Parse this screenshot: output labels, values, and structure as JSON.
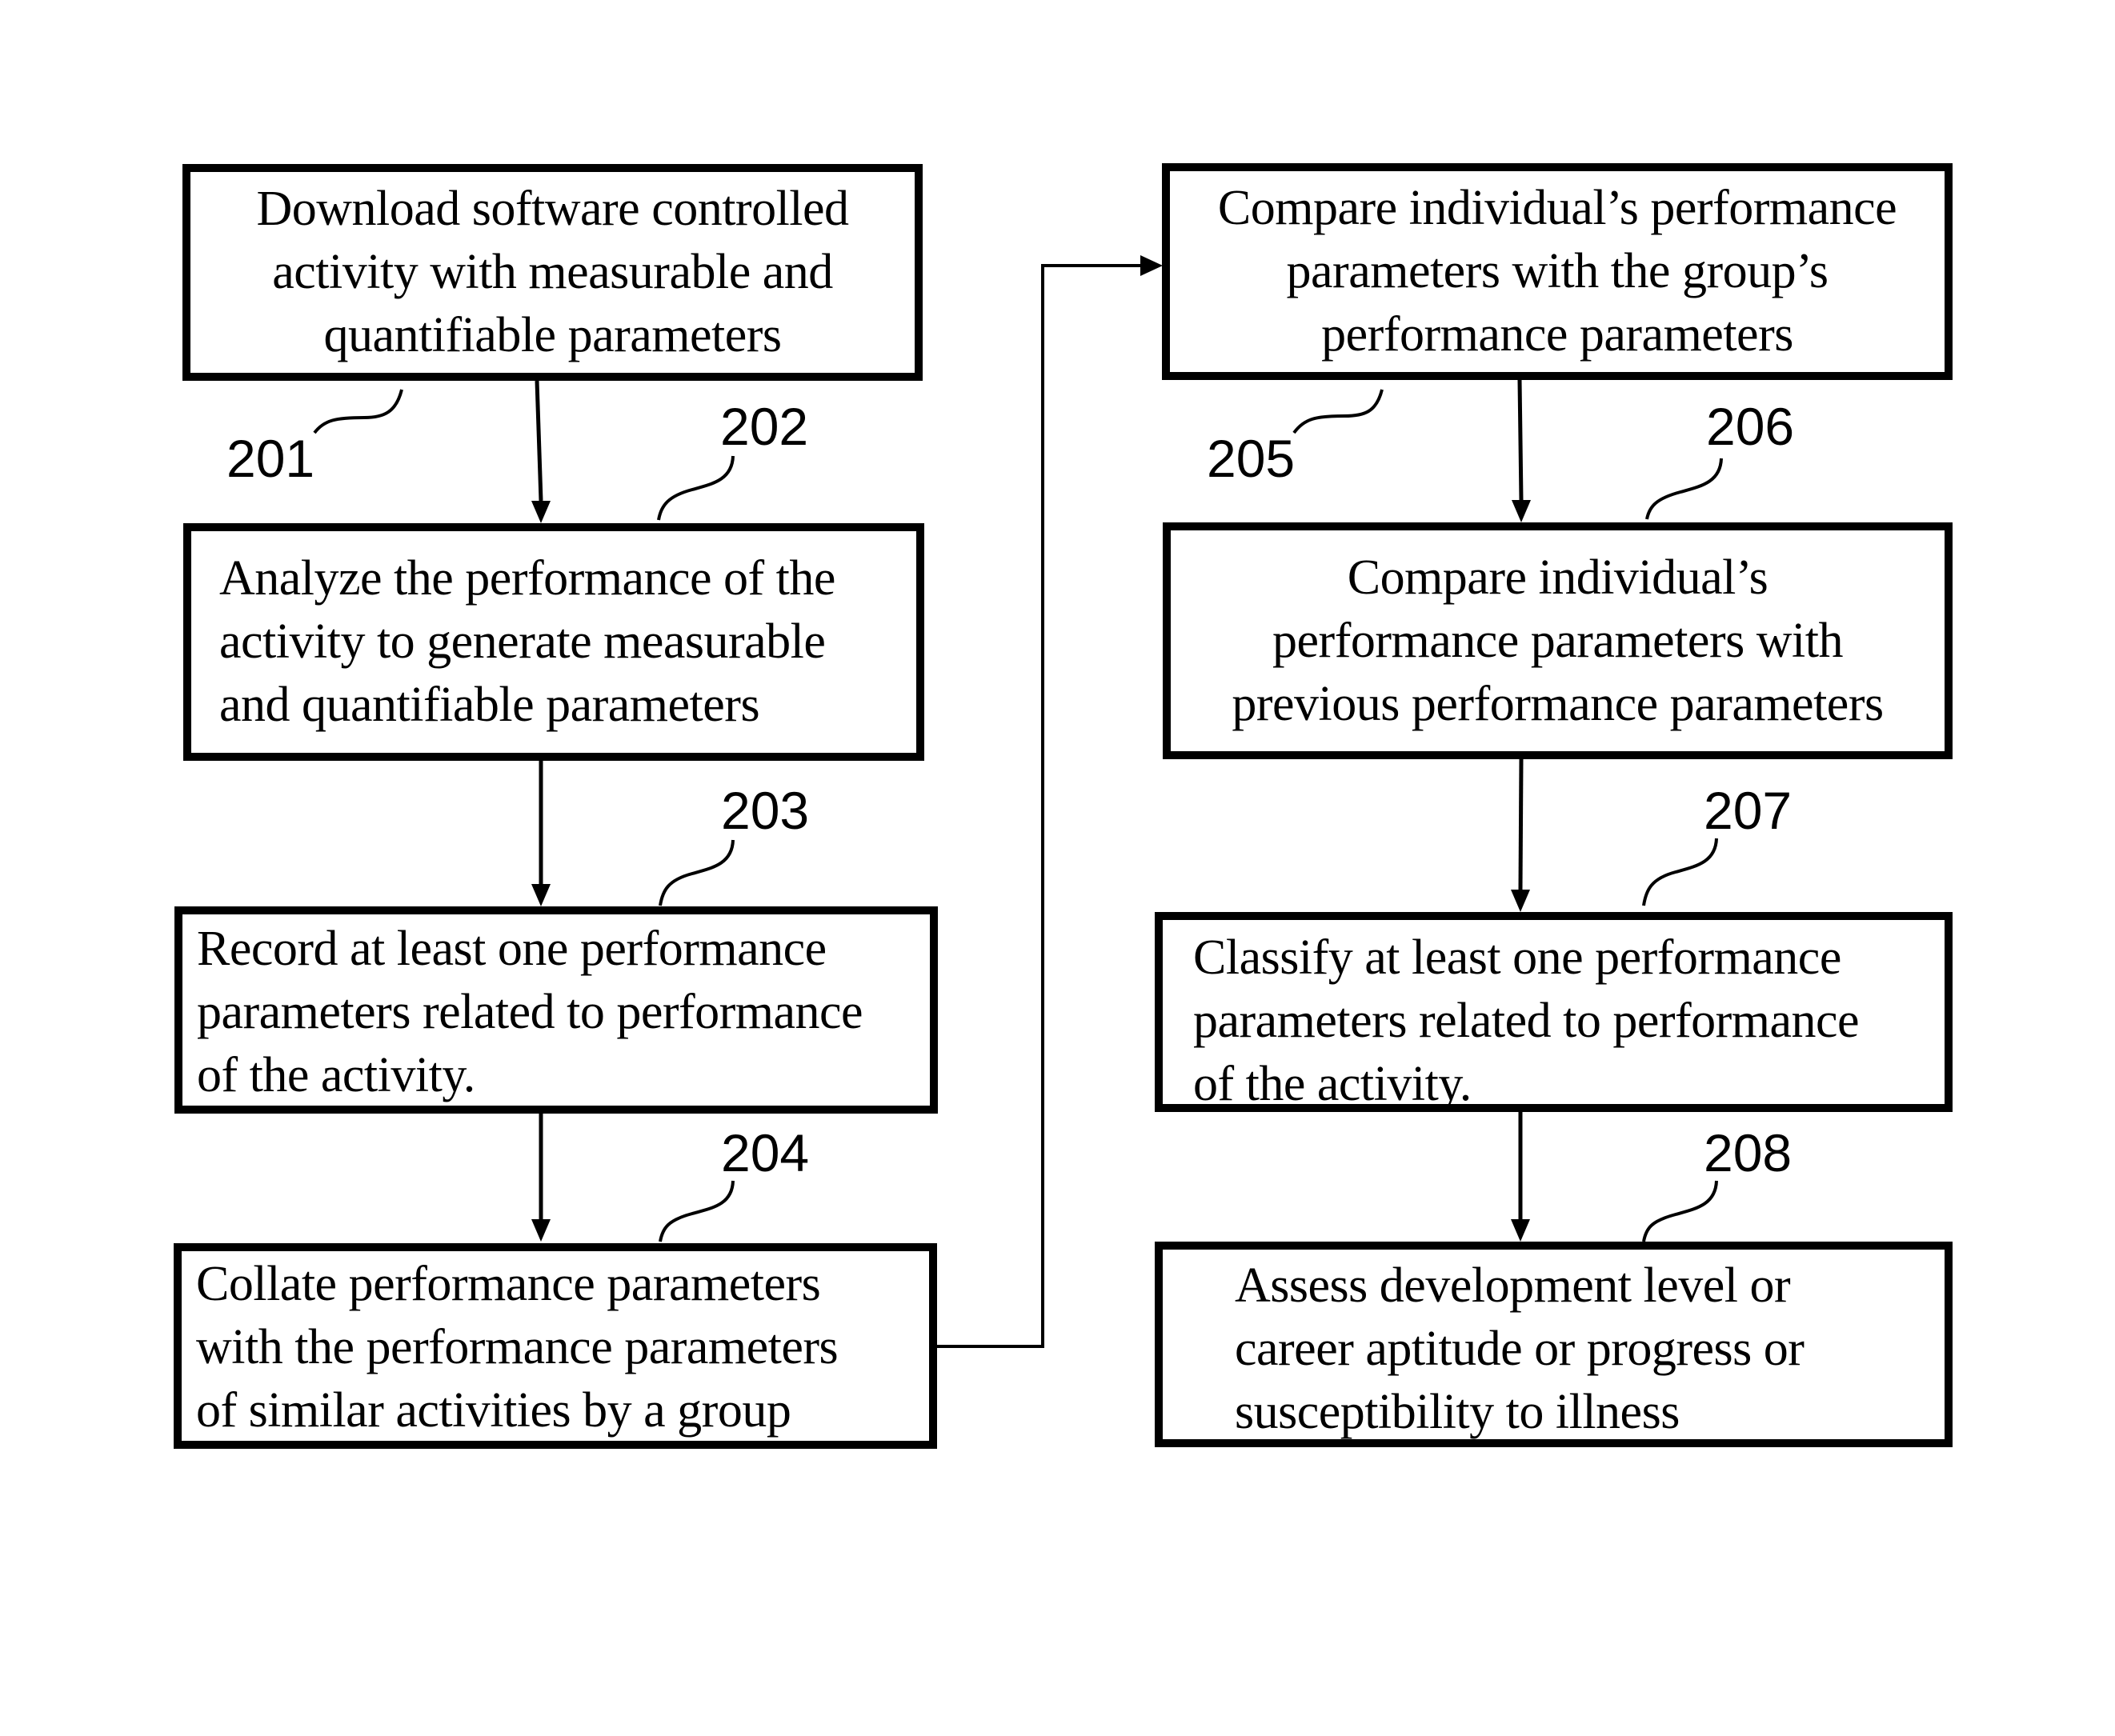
{
  "diagram": {
    "type": "flowchart",
    "steps": [
      {
        "id": "201",
        "lines": [
          "Download software controlled",
          "activity with measurable and",
          "quantifiable parameters"
        ]
      },
      {
        "id": "202",
        "lines": [
          "Analyze the performance of the",
          "activity to generate measurable",
          "and quantifiable parameters"
        ]
      },
      {
        "id": "203",
        "lines": [
          "Record at least one performance",
          "parameters related to performance",
          "of the activity."
        ]
      },
      {
        "id": "204",
        "lines": [
          "Collate performance parameters",
          "with the performance parameters",
          "of similar activities by a group"
        ]
      },
      {
        "id": "205",
        "lines": [
          "Compare individual’s performance",
          "parameters with the group’s",
          "performance parameters"
        ]
      },
      {
        "id": "206",
        "lines": [
          "Compare individual’s",
          "performance parameters with",
          "previous performance parameters"
        ]
      },
      {
        "id": "207",
        "lines": [
          "Classify at least one performance",
          "parameters related to performance",
          "of the activity."
        ]
      },
      {
        "id": "208",
        "lines": [
          "Assess development level or",
          "career aptitude or progress or",
          "susceptibility to illness"
        ]
      }
    ],
    "flow": [
      [
        "201",
        "202"
      ],
      [
        "202",
        "203"
      ],
      [
        "203",
        "204"
      ],
      [
        "204",
        "205"
      ],
      [
        "205",
        "206"
      ],
      [
        "206",
        "207"
      ],
      [
        "207",
        "208"
      ]
    ],
    "colors": {
      "stroke": "#000000",
      "background": "#ffffff"
    }
  }
}
